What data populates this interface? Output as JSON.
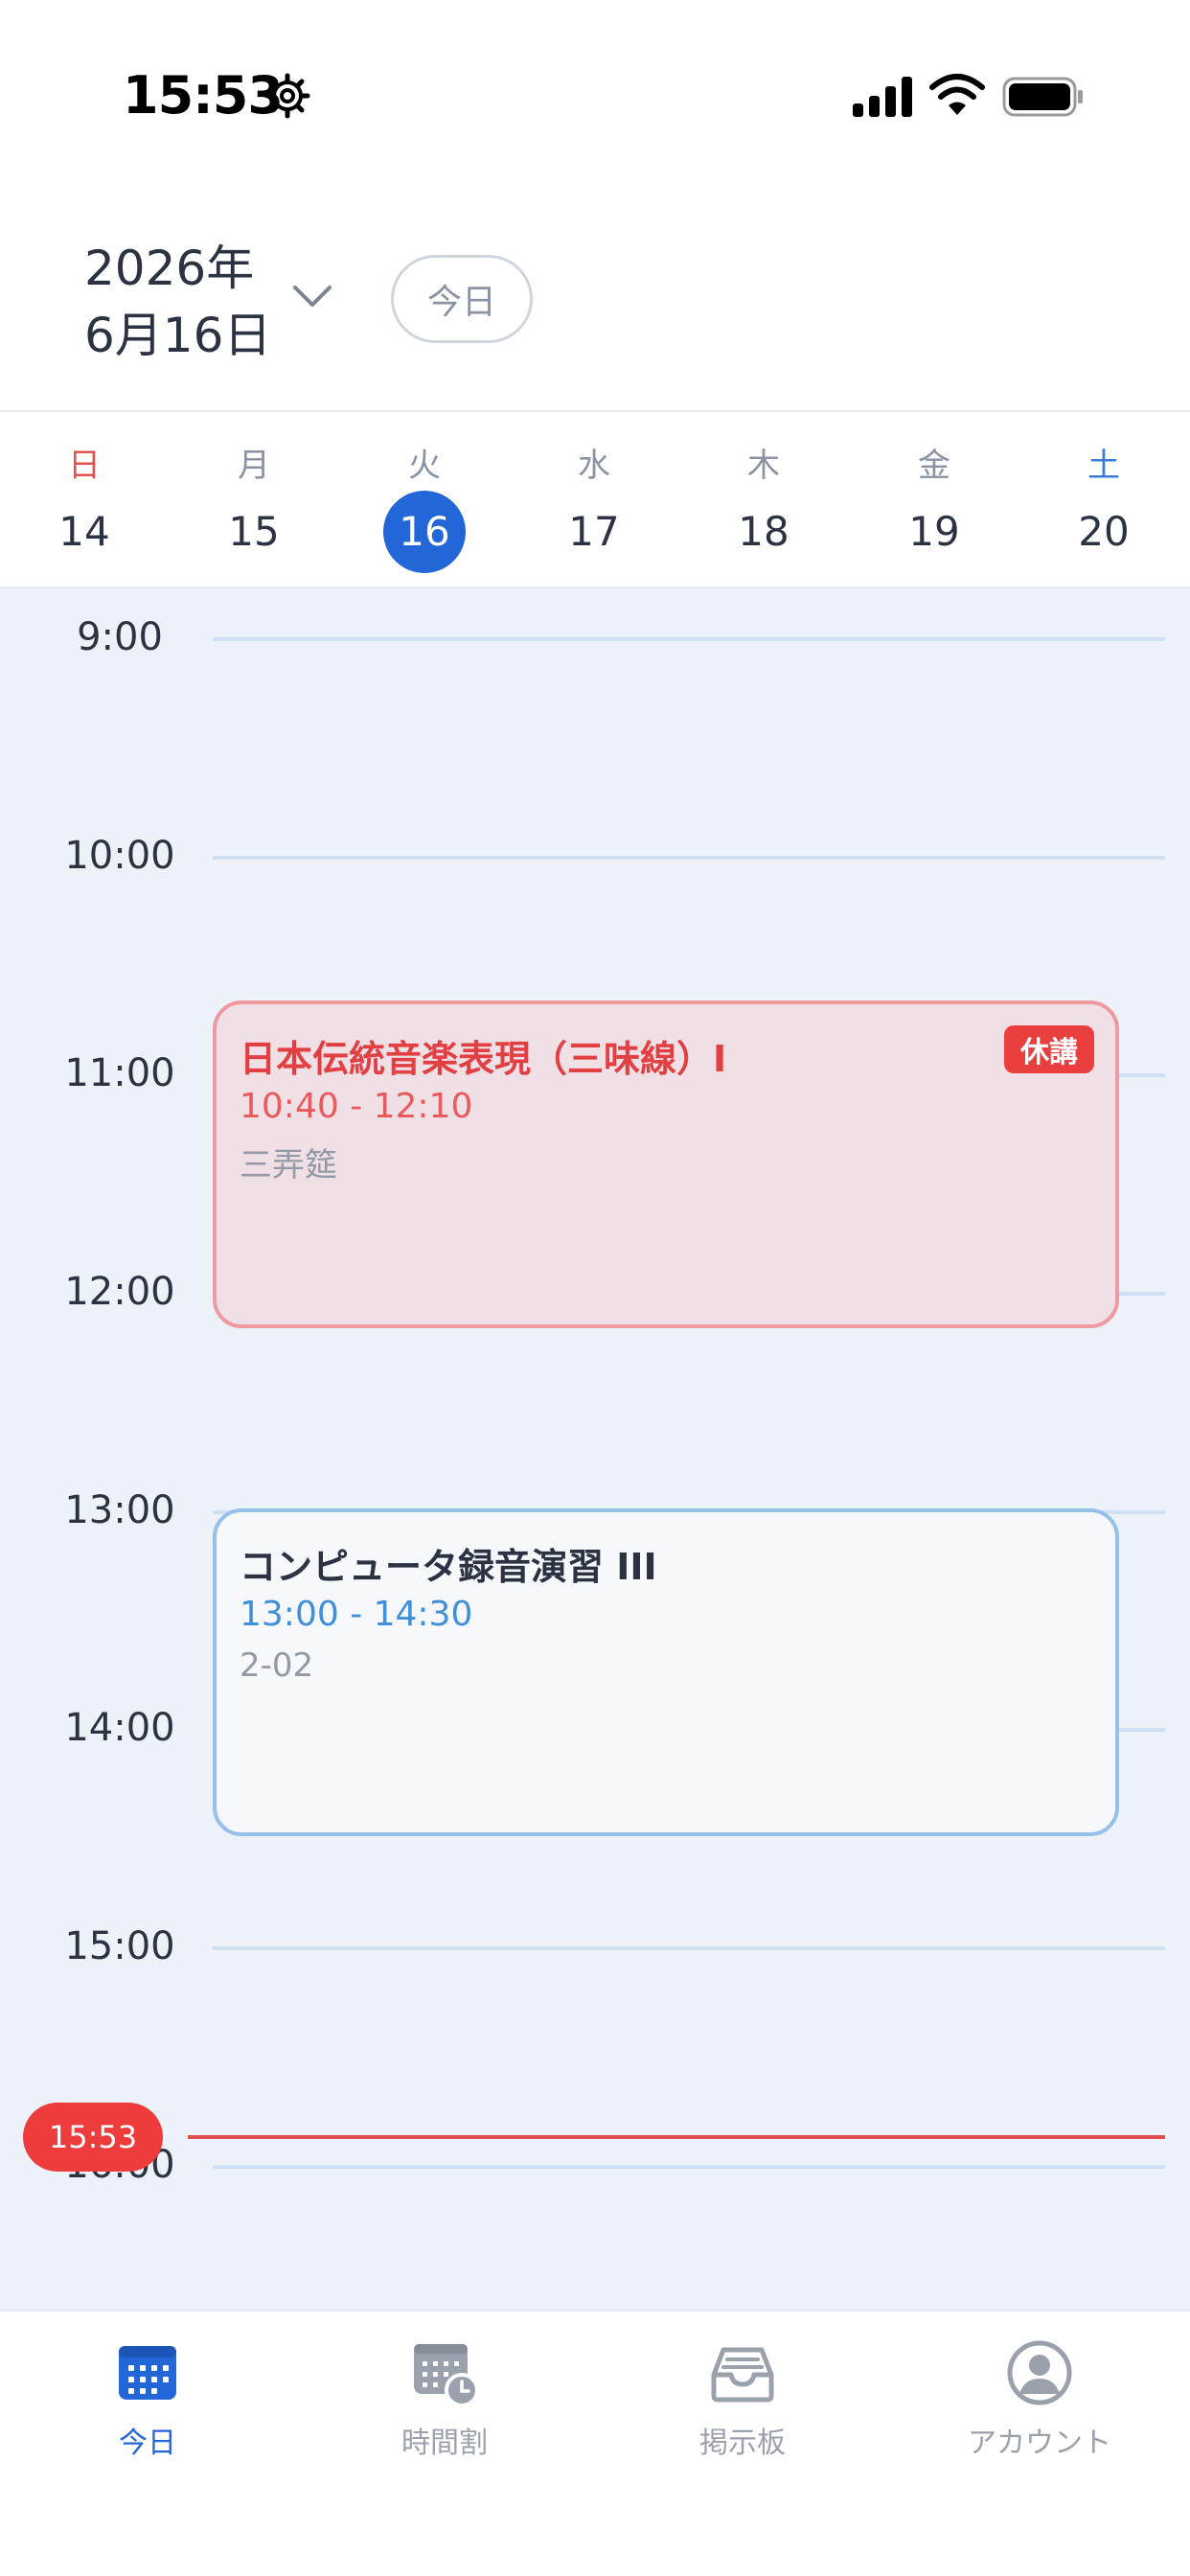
{
  "status_bar": {
    "time": "15:53"
  },
  "header": {
    "year": "2026年",
    "month_day": "6月16日",
    "today_button": "今日"
  },
  "week": [
    {
      "name": "日",
      "num": "14"
    },
    {
      "name": "月",
      "num": "15"
    },
    {
      "name": "火",
      "num": "16",
      "selected": true
    },
    {
      "name": "水",
      "num": "17"
    },
    {
      "name": "木",
      "num": "18"
    },
    {
      "name": "金",
      "num": "19"
    },
    {
      "name": "土",
      "num": "20"
    }
  ],
  "timeline": {
    "hours": [
      "9:00",
      "10:00",
      "11:00",
      "12:00",
      "13:00",
      "14:00",
      "15:00",
      "16:00"
    ],
    "now": "15:53",
    "events": [
      {
        "title": "日本伝統音楽表現（三味線）I",
        "time": "10:40 - 12:10",
        "room": "三弄筵",
        "badge": "休講"
      },
      {
        "title": "コンピュータ録音演習 III",
        "time": "13:00 - 14:30",
        "room": "2-02"
      }
    ]
  },
  "tabs": [
    {
      "label": "今日",
      "active": true
    },
    {
      "label": "時間割"
    },
    {
      "label": "掲示板"
    },
    {
      "label": "アカウント"
    }
  ],
  "colors": {
    "accent": "#2366d7",
    "cancel": "#ea3e3f",
    "timeline_bg": "#edf2f9",
    "event_blue": "#95c0ea"
  }
}
